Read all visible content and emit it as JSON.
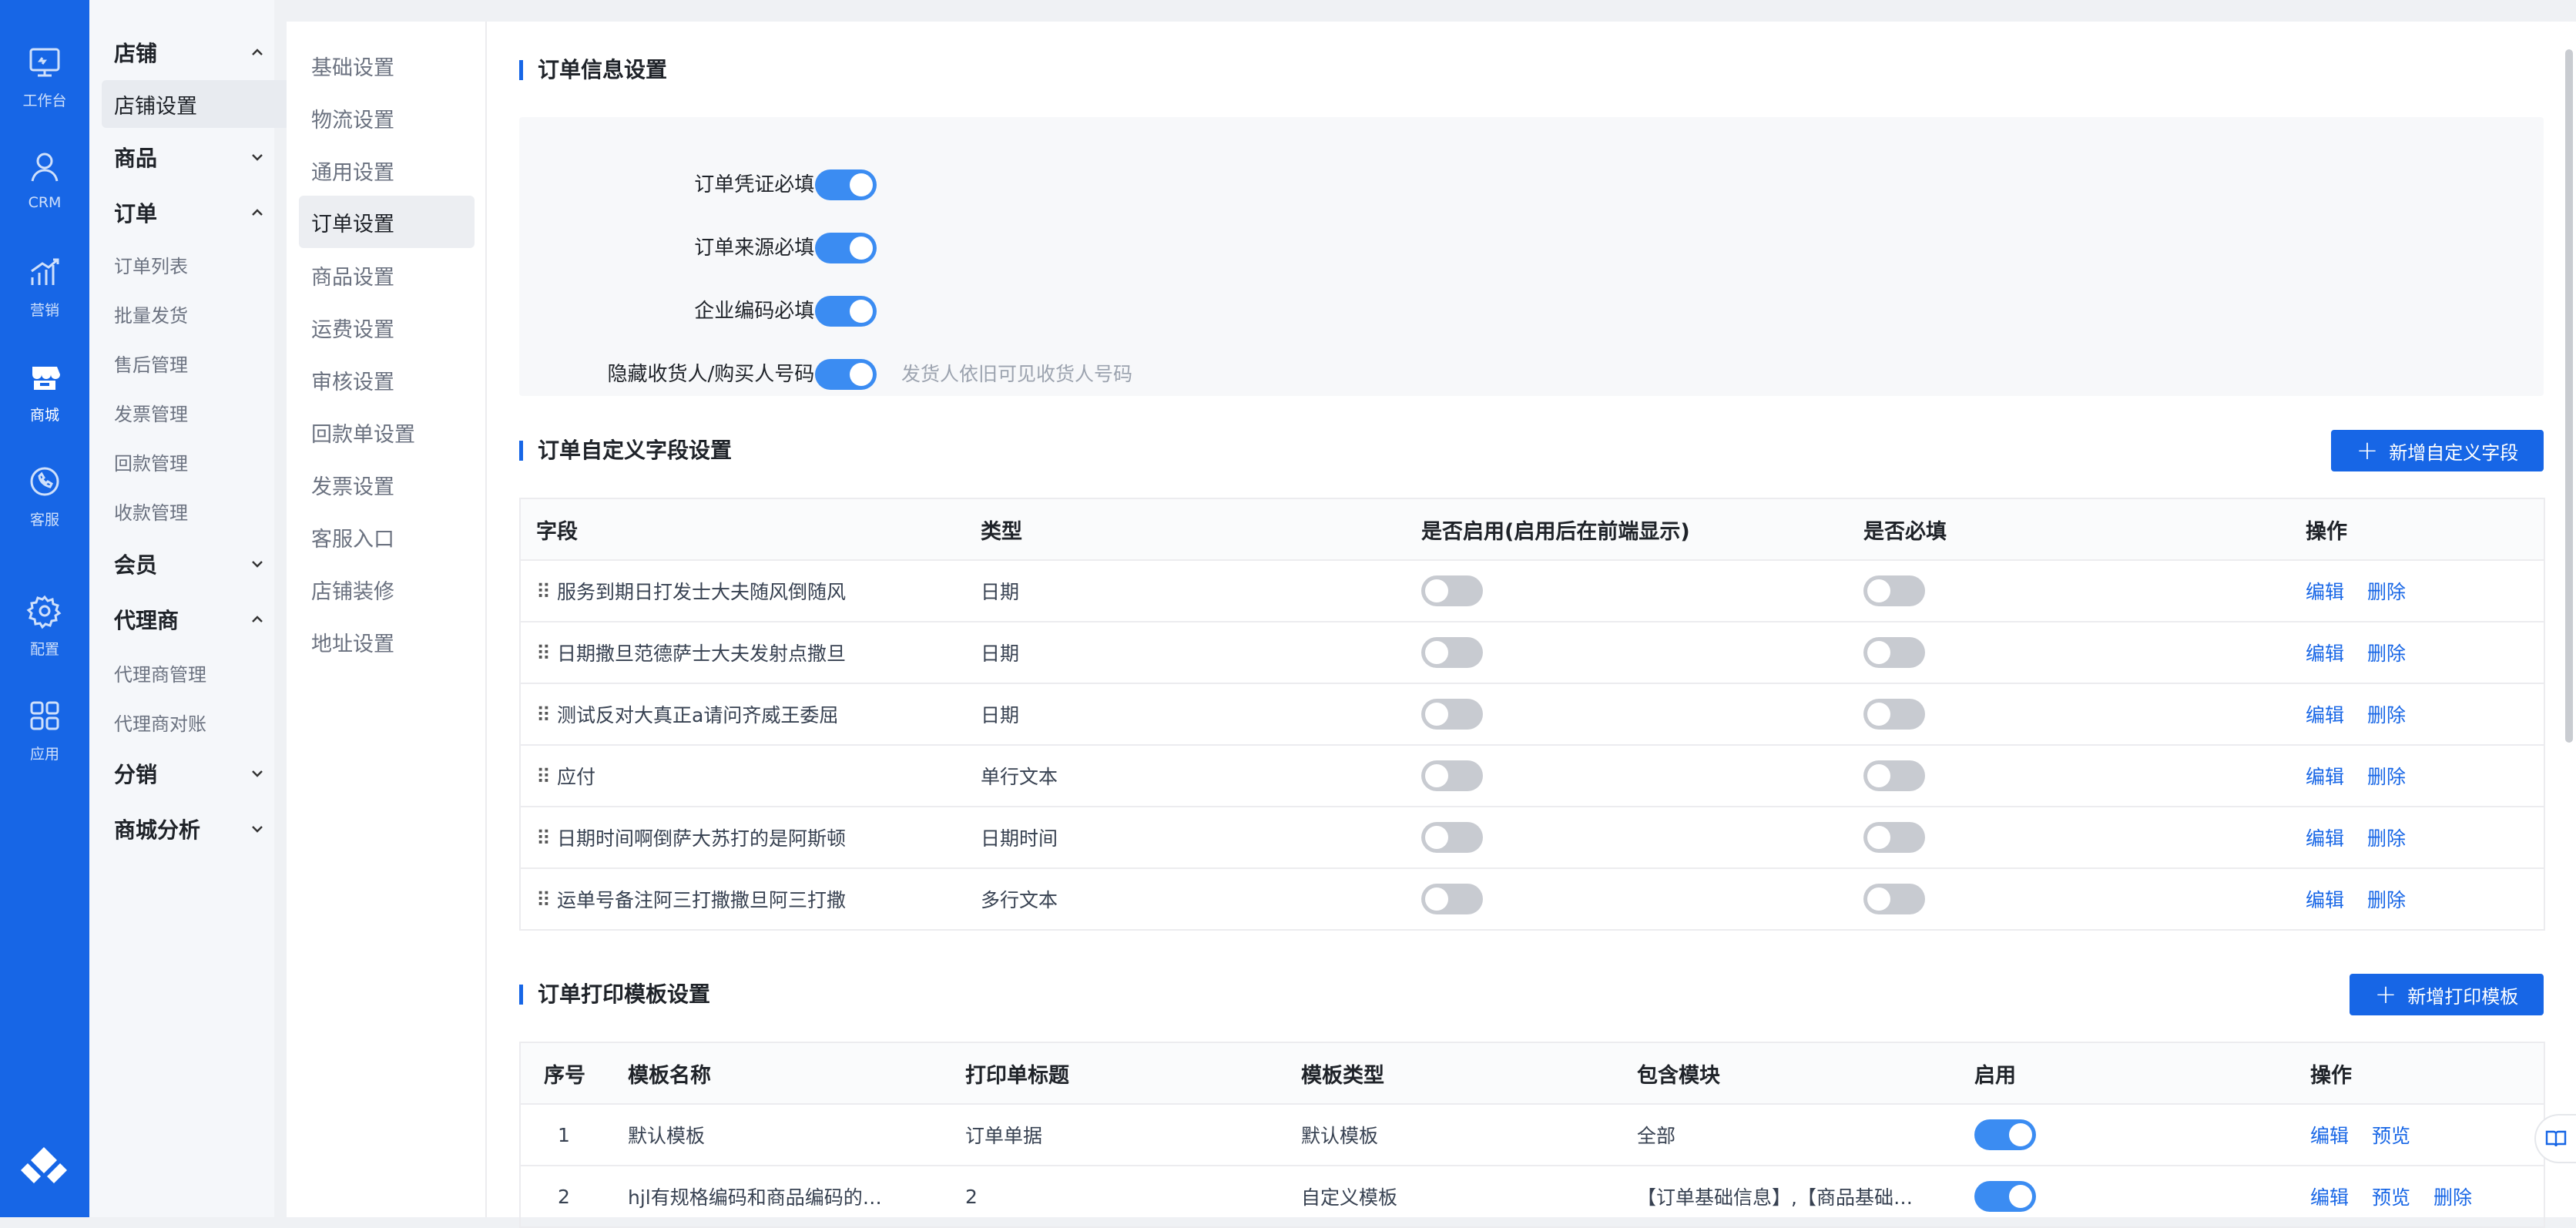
{
  "rail": [
    {
      "label": "工作台",
      "icon": "monitor-icon"
    },
    {
      "label": "CRM",
      "icon": "user-icon"
    },
    {
      "label": "营销",
      "icon": "chart-growth-icon"
    },
    {
      "label": "商城",
      "icon": "shop-icon"
    },
    {
      "label": "客服",
      "icon": "phone-icon"
    },
    {
      "label": "配置",
      "icon": "gear-icon"
    },
    {
      "label": "应用",
      "icon": "apps-grid-icon"
    }
  ],
  "menu": {
    "groups": {
      "store": "店铺",
      "store_settings": "店铺设置",
      "product": "商品",
      "order": "订单",
      "order_list": "订单列表",
      "batch_ship": "批量发货",
      "after_sales": "售后管理",
      "invoice": "发票管理",
      "refund": "回款管理",
      "payment": "收款管理",
      "member": "会员",
      "agent": "代理商",
      "agent_manage": "代理商管理",
      "agent_reconcile": "代理商对账",
      "distribution": "分销",
      "analytics": "商城分析"
    }
  },
  "submenu": [
    "基础设置",
    "物流设置",
    "通用设置",
    "订单设置",
    "商品设置",
    "运费设置",
    "审核设置",
    "回款单设置",
    "发票设置",
    "客服入口",
    "店铺装修",
    "地址设置"
  ],
  "order_info": {
    "title": "订单信息设置",
    "options": [
      {
        "label": "订单凭证必填:",
        "on": true,
        "hint": ""
      },
      {
        "label": "订单来源必填:",
        "on": true,
        "hint": ""
      },
      {
        "label": "企业编码必填:",
        "on": true,
        "hint": ""
      },
      {
        "label": "隐藏收货人/购买人号码:",
        "on": true,
        "hint": "发货人依旧可见收货人号码"
      }
    ]
  },
  "custom_fields": {
    "title": "订单自定义字段设置",
    "add_button": "新增自定义字段",
    "headers": [
      "字段",
      "类型",
      "是否启用(启用后在前端显示)",
      "是否必填",
      "操作"
    ],
    "edit": "编辑",
    "delete": "删除",
    "rows": [
      {
        "field": "服务到期日打发士大夫随风倒随风",
        "type": "日期",
        "enabled": false,
        "required": false
      },
      {
        "field": "日期撒旦范德萨士大夫发射点撒旦",
        "type": "日期",
        "enabled": false,
        "required": false
      },
      {
        "field": "测试反对大真正a请问齐威王委屈",
        "type": "日期",
        "enabled": false,
        "required": false
      },
      {
        "field": "应付",
        "type": "单行文本",
        "enabled": false,
        "required": false
      },
      {
        "field": "日期时间啊倒萨大苏打的是阿斯顿",
        "type": "日期时间",
        "enabled": false,
        "required": false
      },
      {
        "field": "运单号备注阿三打撒撒旦阿三打撒",
        "type": "多行文本",
        "enabled": false,
        "required": false
      }
    ]
  },
  "print_templates": {
    "title": "订单打印模板设置",
    "add_button": "新增打印模板",
    "headers": [
      "序号",
      "模板名称",
      "打印单标题",
      "模板类型",
      "包含模块",
      "启用",
      "操作"
    ],
    "edit": "编辑",
    "preview": "预览",
    "delete": "删除",
    "rows": [
      {
        "no": "1",
        "name": "默认模板",
        "print_title": "订单单据",
        "type": "默认模板",
        "modules": "全部",
        "enabled": true
      },
      {
        "no": "2",
        "name": "hjl有规格编码和商品编码的…",
        "print_title": "2",
        "type": "自定义模板",
        "modules": "【订单基础信息】,【商品基础…",
        "enabled": true
      }
    ]
  }
}
